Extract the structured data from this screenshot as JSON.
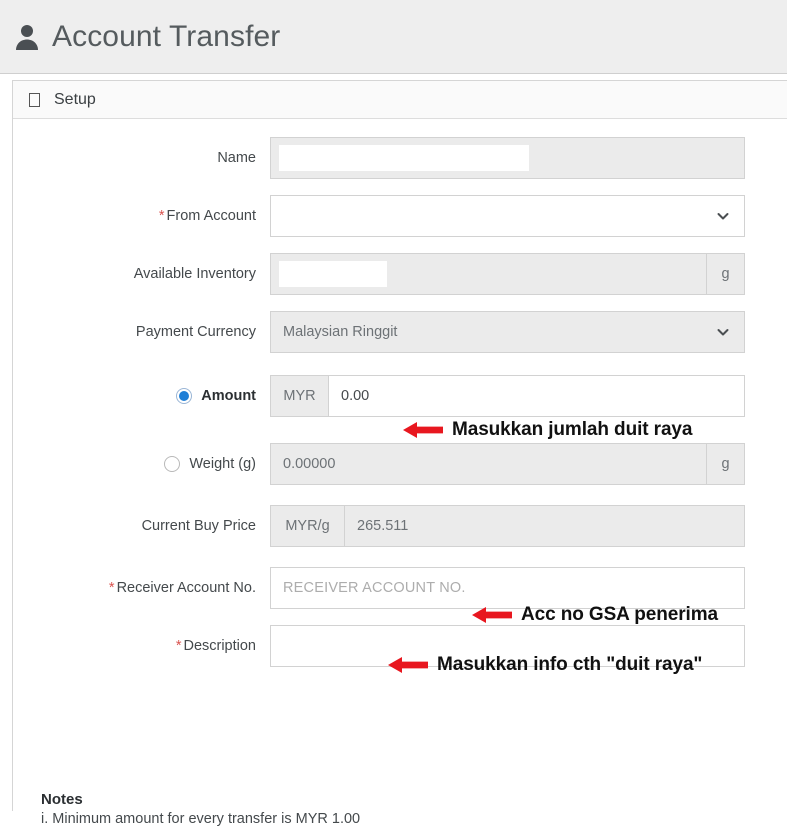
{
  "header": {
    "title": "Account Transfer",
    "icon": "user-icon"
  },
  "panel": {
    "heading": "Setup",
    "collapse_icon": "collapse-box-icon"
  },
  "form": {
    "name": {
      "label": "Name",
      "value": "",
      "redacted": true,
      "disabled": true
    },
    "from_account": {
      "label": "From Account",
      "required_mark": "*",
      "value": "",
      "chevron_icon": "chevron-down-icon"
    },
    "available_inventory": {
      "label": "Available Inventory",
      "value": "",
      "redacted": true,
      "unit": "g",
      "disabled": true
    },
    "payment_currency": {
      "label": "Payment Currency",
      "value": "Malaysian Ringgit",
      "chevron_icon": "chevron-down-icon"
    },
    "amount": {
      "label": "Amount",
      "selected": true,
      "prefix": "MYR",
      "value": "0.00"
    },
    "weight": {
      "label": "Weight (g)",
      "selected": false,
      "value": "0.00000",
      "unit": "g",
      "disabled": true
    },
    "current_buy_price": {
      "label": "Current Buy Price",
      "prefix": "MYR/g",
      "value": "265.511",
      "disabled": true
    },
    "receiver_account_no": {
      "label": "Receiver Account No.",
      "required_mark": "*",
      "placeholder": "RECEIVER ACCOUNT NO.",
      "value": ""
    },
    "description": {
      "label": "Description",
      "required_mark": "*",
      "placeholder": "",
      "value": ""
    }
  },
  "annotations": {
    "amount": "Masukkan jumlah duit raya",
    "receiver": "Acc no GSA penerima",
    "description": "Masukkan info cth \"duit raya\"",
    "arrow_icon": "left-arrow-icon",
    "color": "#e8171f"
  },
  "notes": {
    "title": "Notes",
    "items": [
      "i. Minimum amount for every transfer is MYR 1.00"
    ]
  }
}
